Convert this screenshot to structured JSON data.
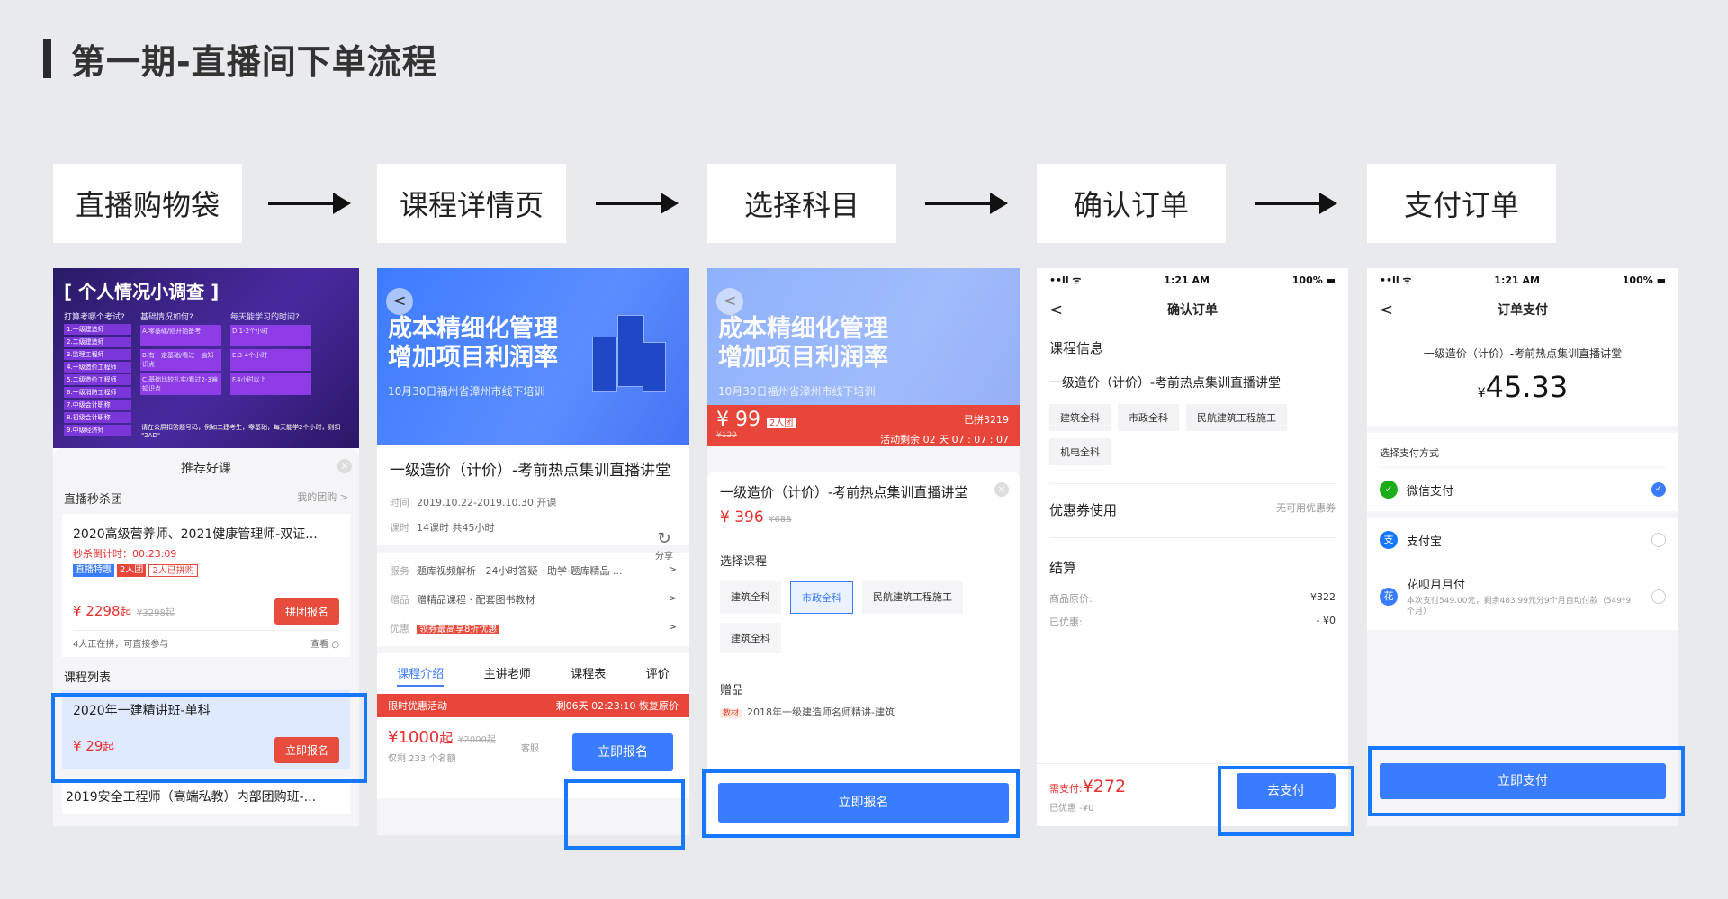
{
  "title": "第一期-直播间下单流程",
  "steps": [
    "直播购物袋",
    "课程详情页",
    "选择科目",
    "确认订单",
    "支付订单"
  ],
  "colors": {
    "accent": "#1677ff",
    "primary": "#3a7cff",
    "price": "#e83030"
  },
  "screen1": {
    "banner_title": "[ 个人情况小调查 ]",
    "q1": "打算考哪个考试?",
    "q2": "基础情况如何?",
    "q3": "每天能学习的时间?",
    "q1_options": [
      "1.一级建造师",
      "2.二级建造师",
      "3.监理工程师",
      "4.一级造价工程师",
      "5.二级造价工程师",
      "6.一级消防工程师",
      "7.中级会计职称",
      "8.初级会计职称",
      "9.中级经济师"
    ],
    "q2_options": [
      "A.零基础/刚开始备考",
      "B.有一定基础/看过一遍知识点",
      "C.基础比较扎实/看过2-3遍知识点"
    ],
    "q3_options": [
      "D.1-2个小时",
      "E.3-4个小时",
      "F.4小时以上"
    ],
    "banner_footer": "请在公屏扣答题号码，例如二建考生，零基础，每天能学2个小时，则扣 \"2AD\"",
    "sheet_title": "推荐好课",
    "close_icon": "×",
    "group_title": "直播秒杀团",
    "group_link": "我的团购 >",
    "card_title": "2020高级营养师、2021健康管理师-双证...",
    "countdown": "秒杀倒计时：00:23:09",
    "tags": [
      "直播特惠",
      "2人团",
      "2人已拼购"
    ],
    "price": "¥ 2298",
    "price_suffix": "起",
    "orig_price": "¥3298起",
    "group_button": "拼团报名",
    "note": "4人正在拼，可直接参与",
    "note_link": "查看 ○",
    "list_title": "课程列表",
    "selected_title": "2020年一建精讲班-单科",
    "selected_price": "¥ 29",
    "selected_suffix": "起",
    "enroll_button": "立即报名",
    "last_title": "2019安全工程师（高端私教）内部团购班-..."
  },
  "hero": {
    "back_icon": "<",
    "headline1": "成本精细化管理",
    "headline2": "增加项目利润率",
    "subline": "10月30日福州省漳州市线下培训"
  },
  "screen2": {
    "course_title": "一级造价（计价）-考前热点集训直播讲堂",
    "time_label": "时间",
    "time_value": "2019.10.22-2019.10.30 开课",
    "hours_label": "课时",
    "hours_value": "14课时  共45小时",
    "share_icon": "↻",
    "share_label": "分享",
    "service_label": "服务",
    "service_value": "题库视频解析 · 24小时答疑 · 助学·题库精品 ...",
    "gift_label": "赠品",
    "gift_value": "赠精品课程 · 配套图书教材",
    "discount_label": "优惠",
    "discount_value": "领券最高享8折优惠",
    "chevron": ">",
    "tabs": [
      "课程介绍",
      "主讲老师",
      "课程表",
      "评价"
    ],
    "limited": "限时优惠活动",
    "remain": "剩06天 02:23:10 恢复原价",
    "price": "¥1000",
    "price_suffix": "起",
    "orig_price": "¥2000起",
    "sold": "仅剩 233 个名额",
    "service_icon": "客服",
    "enroll_button": "立即报名"
  },
  "screen3": {
    "price": "¥ 99",
    "group_tag": "2人团",
    "orig": "¥129",
    "joined": "已拼3219",
    "countdown": "活动剩余 02 天 07 : 07 : 07",
    "close_icon": "×",
    "course_title": "一级造价（计价）-考前热点集训直播讲堂",
    "sheet_price": "¥ 396",
    "sheet_orig": "¥688",
    "select_label": "选择课程",
    "options": [
      "建筑全科",
      "市政全科",
      "民航建筑工程施工",
      "建筑全科"
    ],
    "selected_index": 1,
    "gift_label": "赠品",
    "gift_tag": "教材",
    "gift_value": "2018年一级建造师名师精讲-建筑",
    "enroll_button": "立即报名"
  },
  "status": {
    "signal": "••ll ᯤ",
    "time": "1:21 AM",
    "battery": "100% ▬"
  },
  "screen4": {
    "nav_back": "<",
    "nav_title": "确认订单",
    "course_header": "课程信息",
    "course_title": "一级造价（计价）-考前热点集训直播讲堂",
    "chips": [
      "建筑全科",
      "市政全科",
      "民航建筑工程施工",
      "机电全科"
    ],
    "coupon_label": "优惠券使用",
    "coupon_value": "无可用优惠券",
    "settle_label": "结算",
    "orig_label": "商品原价:",
    "orig_value": "¥322",
    "discount_label": "已优惠:",
    "discount_value": "- ¥0",
    "pay_label": "需支付:",
    "pay_value": "¥272",
    "saved": "已优惠 -¥0",
    "pay_button": "去支付"
  },
  "screen5": {
    "nav_back": "<",
    "nav_title": "订单支付",
    "course_title": "一级造价（计价）-考前热点集训直播讲堂",
    "currency": "¥",
    "amount": "45.33",
    "method_header": "选择支付方式",
    "methods": [
      {
        "label": "微信支付",
        "icon": "wechat-icon",
        "glyph": "✓",
        "color": "#1aad19",
        "desc": ""
      },
      {
        "label": "支付宝",
        "icon": "alipay-icon",
        "glyph": "支",
        "color": "#1677ff",
        "desc": ""
      },
      {
        "label": "花呗月月付",
        "icon": "huabei-icon",
        "glyph": "花",
        "color": "#3a7cff",
        "desc": "本次支付549.00元，剩余483.99元分9个月自动付款（549*9个月）"
      }
    ],
    "radio_check": "✓",
    "pay_button": "立即支付"
  }
}
